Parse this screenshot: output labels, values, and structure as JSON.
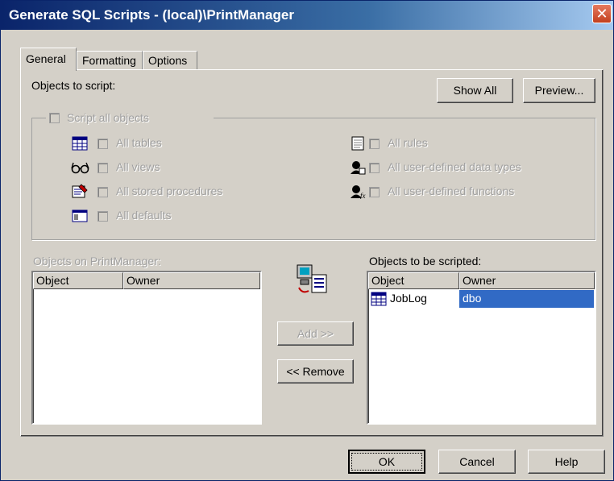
{
  "window": {
    "title": "Generate SQL Scripts - (local)\\PrintManager",
    "close_glyph": "✕"
  },
  "tabs": [
    {
      "label": "General",
      "active": true
    },
    {
      "label": "Formatting",
      "active": false
    },
    {
      "label": "Options",
      "active": false
    }
  ],
  "objects_to_script_label": "Objects to script:",
  "show_all_label": "Show All",
  "preview_label": "Preview...",
  "script_all": {
    "label": "Script all objects",
    "checked": false
  },
  "options_left": [
    {
      "label": "All tables",
      "icon": "table-icon",
      "checked": false
    },
    {
      "label": "All views",
      "icon": "glasses-icon",
      "checked": false
    },
    {
      "label": "All stored procedures",
      "icon": "stored-procedure-icon",
      "checked": false
    },
    {
      "label": "All defaults",
      "icon": "defaults-icon",
      "checked": false
    }
  ],
  "options_right": [
    {
      "label": "All rules",
      "icon": "rule-icon",
      "checked": false
    },
    {
      "label": "All user-defined data types",
      "icon": "user-data-type-icon",
      "checked": false
    },
    {
      "label": "All user-defined functions",
      "icon": "user-function-icon",
      "checked": false
    }
  ],
  "objects_on_label": "Objects on PrintManager:",
  "objects_scripted_label": "Objects to be scripted:",
  "columns": {
    "object": "Object",
    "owner": "Owner"
  },
  "add_label": "Add >>",
  "remove_label": "<< Remove",
  "scripted_rows": [
    {
      "object": "JobLog",
      "owner": "dbo",
      "icon": "table-icon"
    }
  ],
  "footer": {
    "ok": "OK",
    "cancel": "Cancel",
    "help": "Help"
  },
  "colors": {
    "selection": "#316ac5",
    "title_start": "#0a246a",
    "title_end": "#a6caf0"
  }
}
